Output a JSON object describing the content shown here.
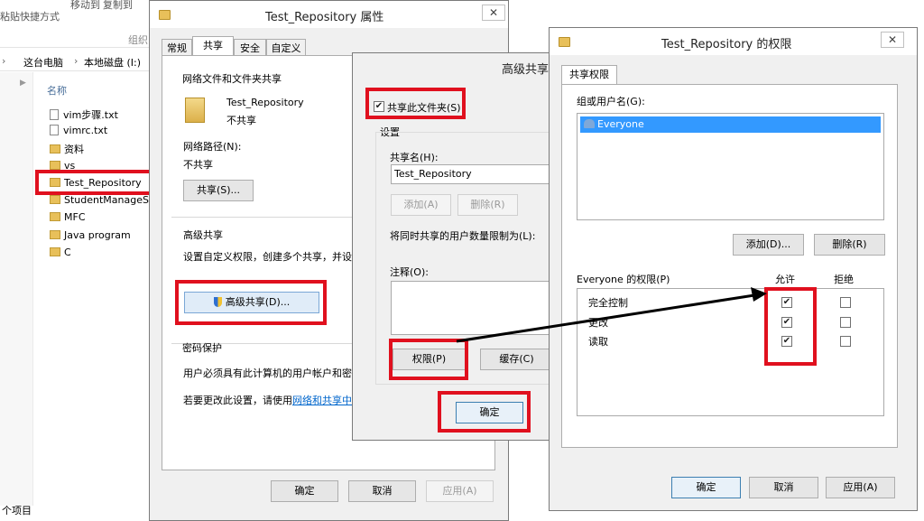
{
  "explorer": {
    "ribbon": {
      "paste_shortcut": "粘贴快捷方式",
      "move_to": "移动到",
      "copy_to": "复制到",
      "organize": "组织"
    },
    "breadcrumb": [
      "这台电脑",
      "本地磁盘 (I:)"
    ],
    "column_name": "名称",
    "items": [
      {
        "name": "vim步骤.txt",
        "type": "txt"
      },
      {
        "name": "vimrc.txt",
        "type": "txt"
      },
      {
        "name": "资料",
        "type": "folder"
      },
      {
        "name": "vs",
        "type": "folder"
      },
      {
        "name": "Test_Repository",
        "type": "folder"
      },
      {
        "name": "StudentManageSy",
        "type": "folder"
      },
      {
        "name": "MFC",
        "type": "folder"
      },
      {
        "name": "Java program",
        "type": "folder"
      },
      {
        "name": "C",
        "type": "folder"
      }
    ],
    "status": "个项目"
  },
  "props": {
    "title": "Test_Repository 属性",
    "tabs": [
      "常规",
      "共享",
      "安全",
      "自定义"
    ],
    "active_tab": "共享",
    "net_share_heading": "网络文件和文件夹共享",
    "folder_name": "Test_Repository",
    "folder_status": "不共享",
    "net_path_label": "网络路径(N):",
    "net_path_value": "不共享",
    "share_button": "共享(S)...",
    "adv_heading": "高级共享",
    "adv_desc": "设置自定义权限，创建多个共享，并设",
    "adv_button": "高级共享(D)...",
    "pw_heading": "密码保护",
    "pw_desc": "用户必须具有此计算机的用户帐户和密",
    "pw_change_prefix": "若要更改此设置，请使用",
    "pw_link": "网络和共享中",
    "ok": "确定",
    "cancel": "取消",
    "apply": "应用(A)"
  },
  "adv": {
    "title": "高级共享",
    "share_checkbox": "共享此文件夹(S)",
    "settings": "设置",
    "share_name_label": "共享名(H):",
    "share_name_value": "Test_Repository",
    "add": "添加(A)",
    "remove": "删除(R)",
    "limit_label": "将同时共享的用户数量限制为(L):",
    "comment_label": "注释(O):",
    "permissions": "权限(P)",
    "caching": "缓存(C)",
    "ok": "确定"
  },
  "perm": {
    "title": "Test_Repository 的权限",
    "tab": "共享权限",
    "group_label": "组或用户名(G):",
    "users": [
      "Everyone"
    ],
    "add": "添加(D)...",
    "remove": "删除(R)",
    "perm_label": "Everyone 的权限(P)",
    "allow": "允许",
    "deny": "拒绝",
    "rows": [
      {
        "name": "完全控制",
        "allow": true,
        "deny": false
      },
      {
        "name": "更改",
        "allow": true,
        "deny": false
      },
      {
        "name": "读取",
        "allow": true,
        "deny": false
      }
    ],
    "ok": "确定",
    "cancel": "取消",
    "apply": "应用(A)"
  },
  "colors": {
    "highlight": "#e0101e",
    "selection": "#3399ff"
  }
}
